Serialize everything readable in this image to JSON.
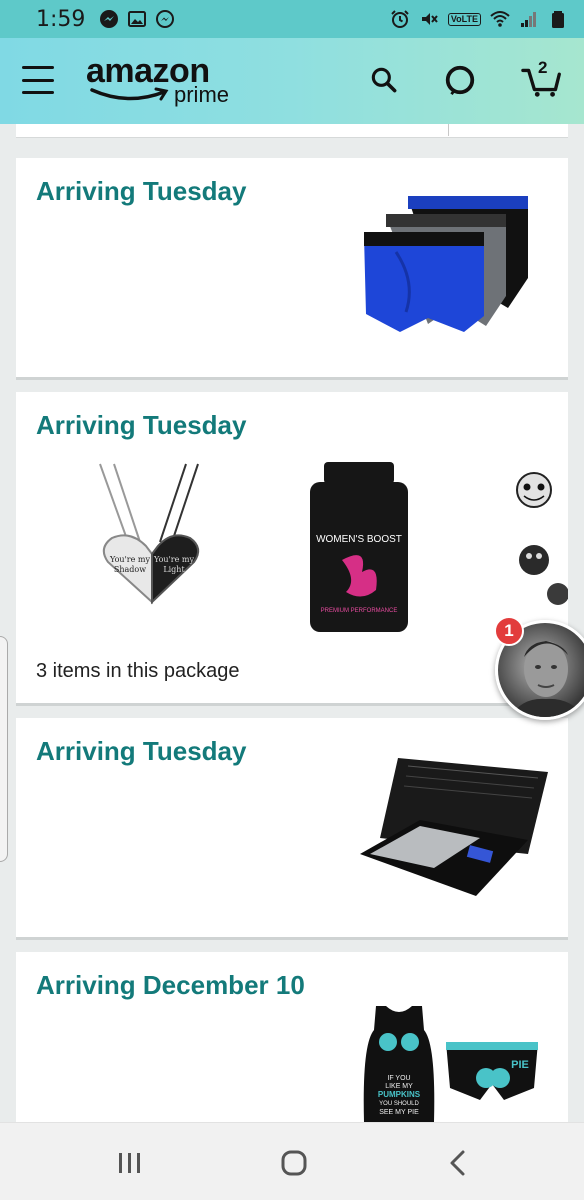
{
  "status_bar": {
    "time": "1:59",
    "left_icons": [
      "messenger-icon",
      "image-icon",
      "messenger-icon"
    ],
    "right_icons": [
      "alarm-icon",
      "mute-icon",
      "volte-icon",
      "wifi-icon",
      "signal-icon",
      "battery-icon"
    ],
    "volte_text": "VoLTE"
  },
  "header": {
    "logo_word": "amazon",
    "logo_sub": "prime",
    "cart_count": "2",
    "background": "#8fdfe0"
  },
  "orders": [
    {
      "title": "Arriving Tuesday",
      "items": [
        "boxer-briefs"
      ],
      "note": ""
    },
    {
      "title": "Arriving Tuesday",
      "items": [
        "heart-necklace",
        "supplement-bottle",
        "skull-earrings"
      ],
      "note": "3 items in this package"
    },
    {
      "title": "Arriving Tuesday",
      "items": [
        "digital-scale"
      ],
      "note": ""
    },
    {
      "title": "Arriving December 10",
      "items": [
        "pumpkin-tank-top",
        "pie-shorts"
      ],
      "note": ""
    }
  ],
  "product_text": {
    "necklace_left": "You're my Shadow",
    "necklace_right": "You're my Light",
    "bottle_brand": "WOMEN'S BOOST",
    "bottle_tag": "PREMIUM PERFORMANCE",
    "shirt_text": "IF YOU LIKE MY PUMPKINS YOU SHOULD SEE MY PIE",
    "shorts_text": "PIE"
  },
  "chat_head": {
    "badge": "1"
  },
  "accent_color": "#137a7a"
}
